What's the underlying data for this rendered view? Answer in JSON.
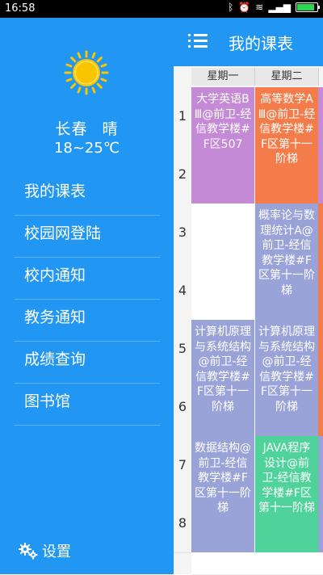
{
  "status_bar": {
    "time": "16:58"
  },
  "toolbar": {
    "title": "我的课表"
  },
  "drawer": {
    "city": "长春",
    "weather": "晴",
    "temperature": "18~25℃",
    "menu": [
      "我的课表",
      "校园网登陆",
      "校内通知",
      "教务通知",
      "成绩查询",
      "图书馆"
    ],
    "settings_label": "设置"
  },
  "timetable": {
    "days": [
      "星期一",
      "星期二"
    ],
    "periods": [
      "1",
      "2",
      "3",
      "4",
      "5",
      "6",
      "7",
      "8"
    ],
    "courses": {
      "mon_1_2": "大学英语BⅢ@前卫-经信教学楼#F区507",
      "tue_1_2": "高等数学AⅢ@前卫-经信教学楼#F区第十一阶梯",
      "tue_3_4": "概率论与数理统计A@前卫-经信教学楼#F区第十一阶梯",
      "mon_5_6": "计算机原理与系统结构@前卫-经信教学楼#F区第十一阶梯",
      "tue_5_6": "计算机原理与系统结构@前卫-经信教学楼#F区第十一阶梯",
      "mon_7_8": "数据结构@前卫-经信教学楼#F区第十一阶梯",
      "tue_7_8": "JAVA程序设计@前卫-经信教学楼#F区第十一阶梯"
    },
    "colors": {
      "purple": "#c58ad6",
      "orange": "#f47c4a",
      "lavender": "#9aa3d8",
      "green": "#4fd39a"
    }
  }
}
